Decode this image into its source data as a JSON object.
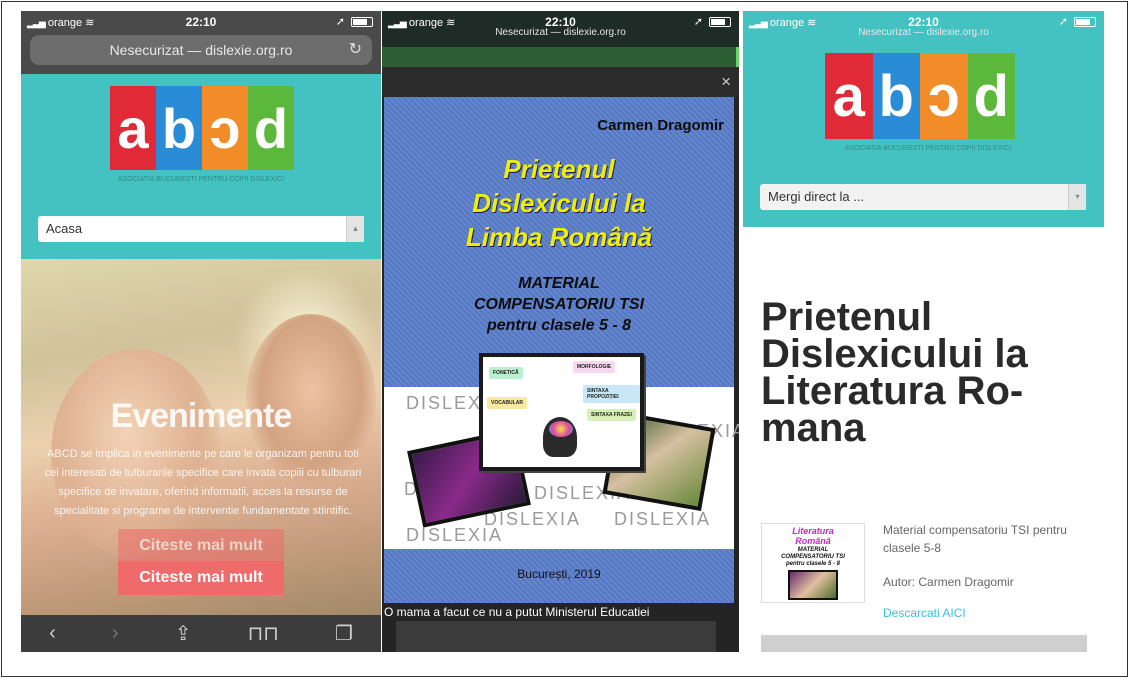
{
  "status": {
    "carrier": "orange",
    "time": "22:10"
  },
  "phone1": {
    "url_text": "Nesecurizat — dislexie.org.ro",
    "logo_letters": [
      "a",
      "b",
      "ɔ",
      "d"
    ],
    "logo_colors": [
      "#e02a37",
      "#2a8bd6",
      "#f28c28",
      "#5cb83a"
    ],
    "org_name": "ASOCIATIA BUCURESTI PENTRU COPII DISLEXICI",
    "nav_select": "Acasa",
    "hero_title": "Evenimente",
    "hero_text": "ABCD se implica in evenimente pe care le organizam pentru toti cei interesati de tulburarile specifice care invata copiii cu tulburari specifice de invatare, oferind informatii, acces la resurse de specialitate si programe de interventie fundamentate stiintific.",
    "button_1": "Citeste mai mult",
    "button_2": "Citeste mai mult"
  },
  "phone2": {
    "url_text": "Nesecurizat — dislexie.org.ro",
    "close": "×",
    "book": {
      "author": "Carmen Dragomir",
      "title_l1": "Prietenul",
      "title_l2": "Dislexicului la",
      "title_l3": "Limba Română",
      "sub_l1": "MATERIAL",
      "sub_l2": "COMPENSATORIU TSI",
      "sub_l3": "pentru clasele 5 - 8",
      "dis_word": "DISLEXIA",
      "mind": [
        "FONETICĂ",
        "MORFOLOGIE",
        "SINTAXA PROPOZIȚIEI",
        "VOCABULAR",
        "SINTAXA FRAZEI"
      ],
      "city": "București, 2019"
    },
    "caption": "O mama a facut ce nu a putut Ministerul Educatiei"
  },
  "phone3": {
    "url_text": "Nesecurizat — dislexie.org.ro",
    "org_name": "ASOCIATIA BUCURESTI PENTRU COPII DISLEXICI",
    "nav_select": "Mergi direct la ...",
    "title_l1": "Prietenul",
    "title_l2": "Dislexicului la",
    "title_l3": "Literatura Ro-",
    "title_l4": "mana",
    "thumb_title_l1": "Literatura",
    "thumb_title_l2": "Română",
    "thumb_sub_l1": "MATERIAL",
    "thumb_sub_l2": "COMPENSATORIU TSI",
    "thumb_sub_l3": "pentru clasele 5 - 8",
    "desc": "Material compensatoriu TSI pentru clasele 5-8",
    "author": "Autor: Carmen Dragomir",
    "download_link": "Descarcati AICI"
  }
}
